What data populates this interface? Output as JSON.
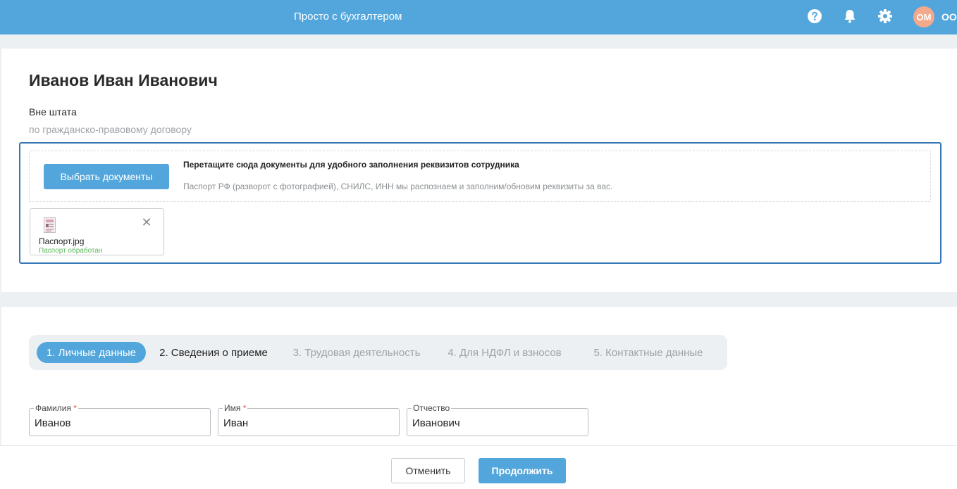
{
  "header": {
    "app_title": "Просто с бухгалтером",
    "avatar_initials": "ОМ",
    "org_name": "ОО",
    "icons": [
      "help-icon",
      "bell-icon",
      "gear-icon"
    ]
  },
  "employee": {
    "name": "Иванов Иван Иванович",
    "status": "Вне штата",
    "contract": "по гражданско-правовому договору"
  },
  "upload": {
    "choose_button": "Выбрать документы",
    "title": "Перетащите сюда документы для удобного заполнения реквизитов сотрудника",
    "subtitle": "Паспорт РФ (разворот с фотографией), СНИЛС, ИНН мы распознаем и заполним/обновим реквизиты за вас.",
    "file": {
      "name": "Паспорт.jpg",
      "status": "Паспорт обработан",
      "close_glyph": "✕"
    }
  },
  "tabs": [
    {
      "label": "1. Личные данные",
      "state": "active"
    },
    {
      "label": "2. Сведения о приеме",
      "state": "current"
    },
    {
      "label": "3. Трудовая деятельность",
      "state": "disabled"
    },
    {
      "label": "4. Для НДФЛ и взносов",
      "state": "disabled"
    },
    {
      "label": "5. Контактные данные",
      "state": "disabled"
    }
  ],
  "form": {
    "last_name": {
      "label": "Фамилия",
      "required": "*",
      "value": "Иванов"
    },
    "first_name": {
      "label": "Имя",
      "required": "*",
      "value": "Иван"
    },
    "patronymic": {
      "label": "Отчество",
      "value": "Иванович"
    }
  },
  "footer": {
    "cancel_label": "Отменить",
    "continue_label": "Продолжить"
  },
  "colors": {
    "accent": "#52a6dc",
    "upload_border": "#3777b6",
    "success": "#5cb85c",
    "required": "#e0574f",
    "avatar": "#f3a98b"
  }
}
